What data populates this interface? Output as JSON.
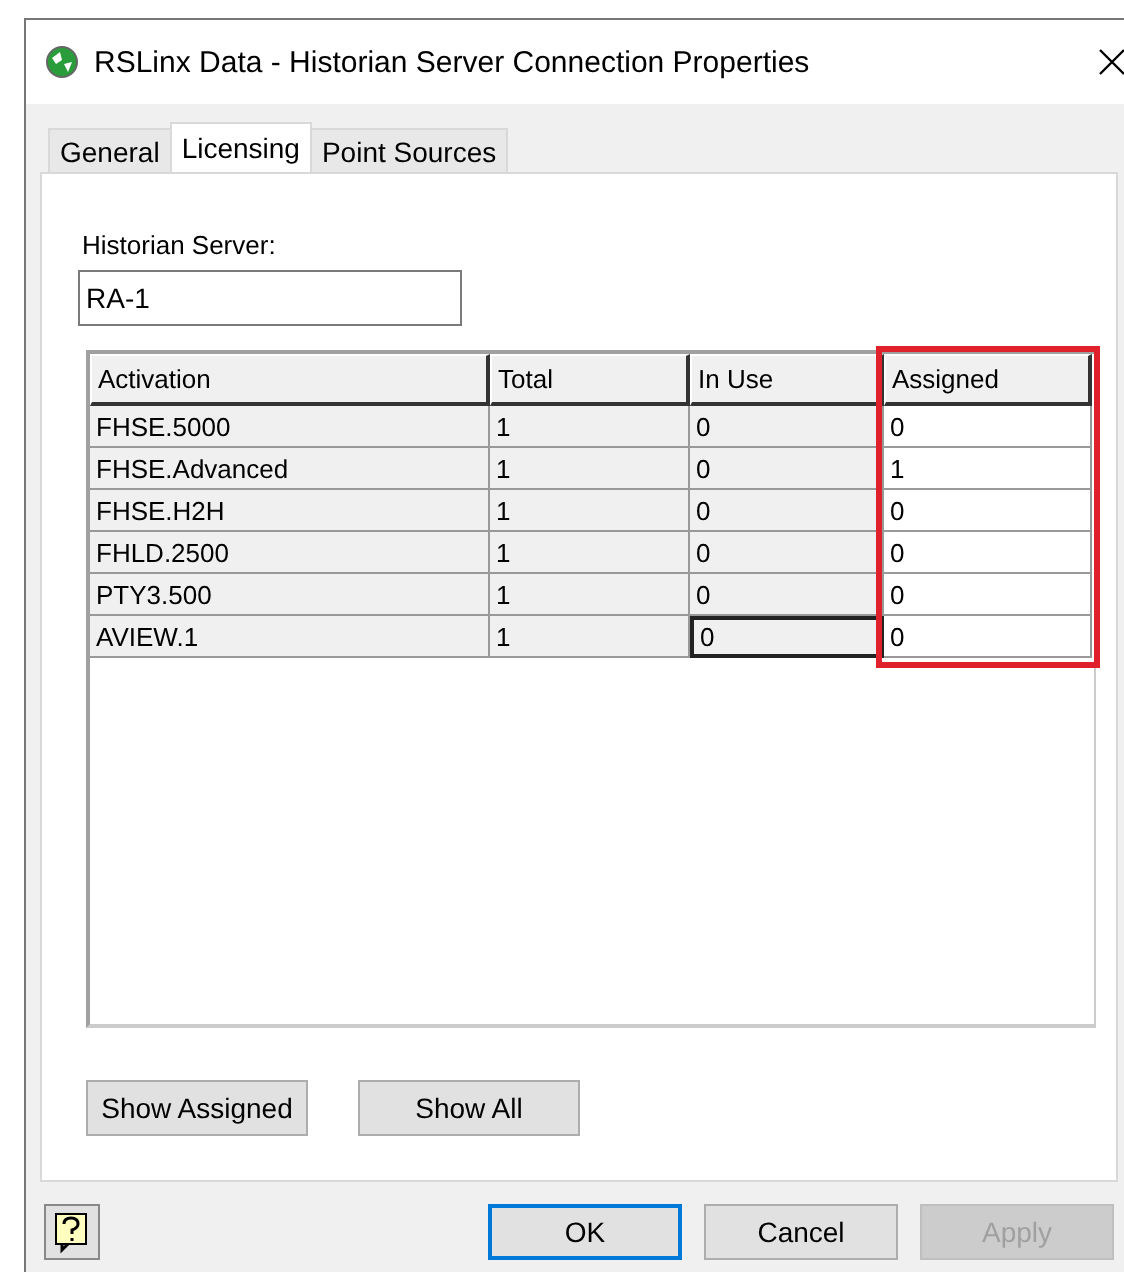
{
  "window": {
    "title": "RSLinx Data - Historian Server Connection Properties"
  },
  "tabs": [
    {
      "label": "General",
      "selected": false
    },
    {
      "label": "Licensing",
      "selected": true
    },
    {
      "label": "Point Sources",
      "selected": false
    }
  ],
  "server": {
    "label": "Historian Server:",
    "value": "RA-1"
  },
  "table": {
    "columns": [
      {
        "label": "Activation",
        "editable": false,
        "highlighted": false
      },
      {
        "label": "Total",
        "editable": false,
        "highlighted": false
      },
      {
        "label": "In Use",
        "editable": false,
        "highlighted": false
      },
      {
        "label": "Assigned",
        "editable": true,
        "highlighted": true
      }
    ],
    "rows": [
      {
        "cells": [
          "FHSE.5000",
          "1",
          "0",
          "0"
        ],
        "focused": false
      },
      {
        "cells": [
          "FHSE.Advanced",
          "1",
          "0",
          "1"
        ],
        "focused": false
      },
      {
        "cells": [
          "FHSE.H2H",
          "1",
          "0",
          "0"
        ],
        "focused": false
      },
      {
        "cells": [
          "FHLD.2500",
          "1",
          "0",
          "0"
        ],
        "focused": false
      },
      {
        "cells": [
          "PTY3.500",
          "1",
          "0",
          "0"
        ],
        "focused": false
      },
      {
        "cells": [
          "AVIEW.1",
          "1",
          "0",
          "0"
        ],
        "focused": true
      }
    ]
  },
  "panel_buttons": [
    "Show Assigned",
    "Show All"
  ],
  "dialog_buttons": [
    {
      "label": "OK",
      "default": true,
      "disabled": false
    },
    {
      "label": "Cancel",
      "default": false,
      "disabled": false
    },
    {
      "label": "Apply",
      "default": false,
      "disabled": true
    }
  ]
}
